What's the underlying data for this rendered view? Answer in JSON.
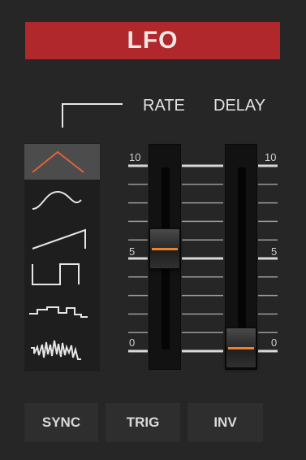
{
  "header": {
    "title": "LFO"
  },
  "columns": {
    "rate_label": "RATE",
    "delay_label": "DELAY"
  },
  "waveforms": {
    "items": [
      {
        "name": "triangle",
        "active": true
      },
      {
        "name": "sine",
        "active": false
      },
      {
        "name": "sawtooth",
        "active": false
      },
      {
        "name": "square",
        "active": false
      },
      {
        "name": "stepped-random",
        "active": false
      },
      {
        "name": "noise",
        "active": false
      }
    ],
    "active_color": "#e0623c",
    "inactive_color": "#e6e6e6"
  },
  "scale": {
    "top": "10",
    "mid": "5",
    "bottom": "0"
  },
  "sliders": {
    "rate": {
      "value": 5.5,
      "min": 0,
      "max": 10
    },
    "delay": {
      "value": 0,
      "min": 0,
      "max": 10
    }
  },
  "buttons": {
    "sync": "SYNC",
    "trig": "TRIG",
    "inv": "INV"
  },
  "colors": {
    "title_bg": "#b0282b",
    "accent": "#f0802a",
    "background": "#262626"
  }
}
